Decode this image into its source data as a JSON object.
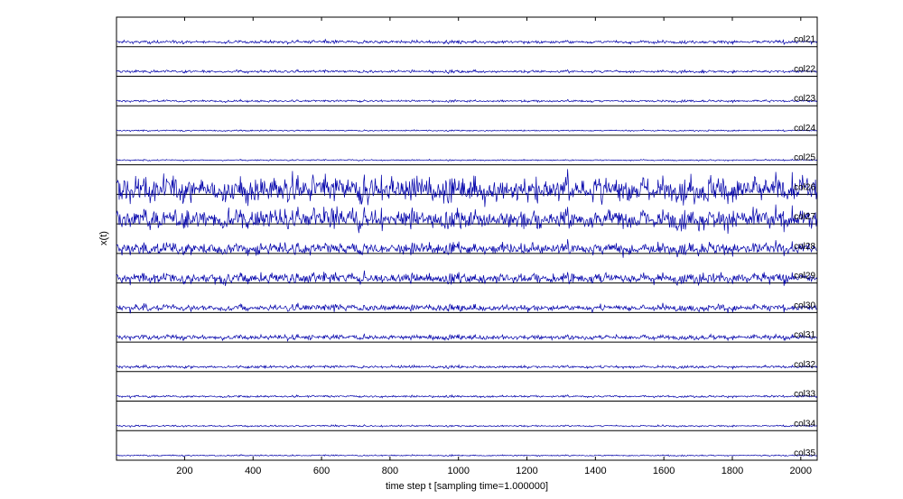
{
  "chart_data": {
    "type": "line",
    "title": "",
    "xlabel": "time step t [sampling time=1.000000]",
    "ylabel": "x(t)",
    "xlim": [
      1,
      2048
    ],
    "x_ticks": [
      200,
      400,
      600,
      800,
      1000,
      1200,
      1400,
      1600,
      1800,
      2000
    ],
    "x_tick_labels": [
      "200",
      "400",
      "600",
      "800",
      "1000",
      "1200",
      "1400",
      "1600",
      "1800",
      "2000"
    ],
    "grid": false,
    "legend": "none",
    "layout": "stacked-strips",
    "line_color": "#0000aa",
    "n_samples": 2048,
    "series": [
      {
        "name": "col21",
        "noise_amplitude": 0.12
      },
      {
        "name": "col22",
        "noise_amplitude": 0.1
      },
      {
        "name": "col23",
        "noise_amplitude": 0.08
      },
      {
        "name": "col24",
        "noise_amplitude": 0.05
      },
      {
        "name": "col25",
        "noise_amplitude": 0.05
      },
      {
        "name": "col26",
        "noise_amplitude": 1.0
      },
      {
        "name": "col27",
        "noise_amplitude": 0.75
      },
      {
        "name": "col28",
        "noise_amplitude": 0.45
      },
      {
        "name": "col29",
        "noise_amplitude": 0.4
      },
      {
        "name": "col30",
        "noise_amplitude": 0.25
      },
      {
        "name": "col31",
        "noise_amplitude": 0.18
      },
      {
        "name": "col32",
        "noise_amplitude": 0.1
      },
      {
        "name": "col33",
        "noise_amplitude": 0.08
      },
      {
        "name": "col34",
        "noise_amplitude": 0.06
      },
      {
        "name": "col35",
        "noise_amplitude": 0.05
      }
    ]
  }
}
